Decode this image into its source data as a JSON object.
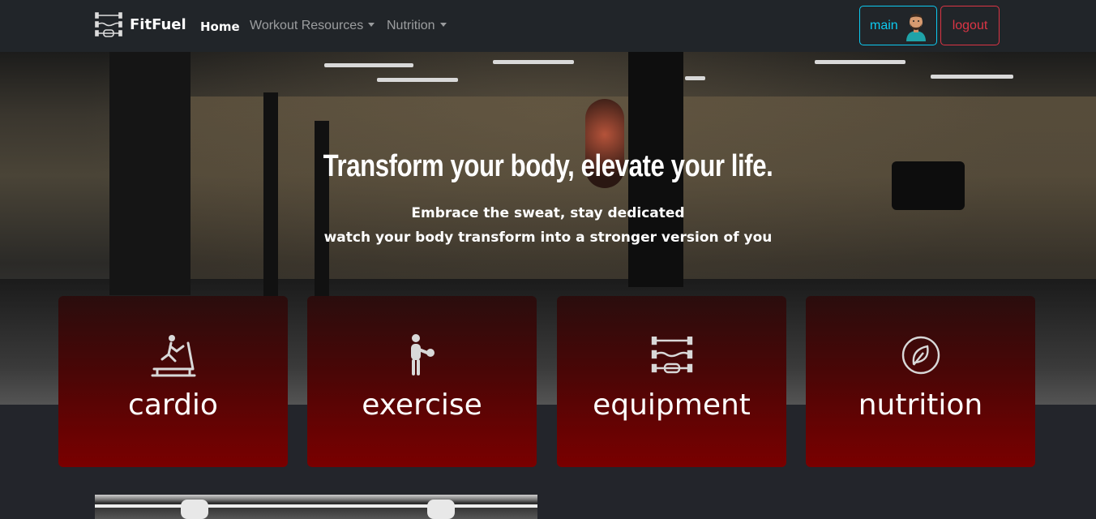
{
  "navbar": {
    "brand": "FitFuel",
    "links": [
      {
        "label": "Home",
        "active": true
      },
      {
        "label": "Workout Resources",
        "dropdown": true
      },
      {
        "label": "Nutrition",
        "dropdown": true
      }
    ],
    "user_button": "main",
    "logout_button": "logout"
  },
  "hero": {
    "title": "Transform your body, elevate your life.",
    "subtitle_line1": "Embrace the sweat, stay dedicated",
    "subtitle_line2": "watch your body transform into a stronger version of you"
  },
  "cards": [
    {
      "label": "cardio",
      "icon": "treadmill-icon"
    },
    {
      "label": "exercise",
      "icon": "medicine-ball-icon"
    },
    {
      "label": "equipment",
      "icon": "barbell-icon"
    },
    {
      "label": "nutrition",
      "icon": "leaf-icon"
    }
  ],
  "colors": {
    "navbar_bg": "#212529",
    "page_bg": "#23252b",
    "info": "#0dcaf0",
    "danger": "#dc3545",
    "card_gradient_end": "#7a0000"
  }
}
